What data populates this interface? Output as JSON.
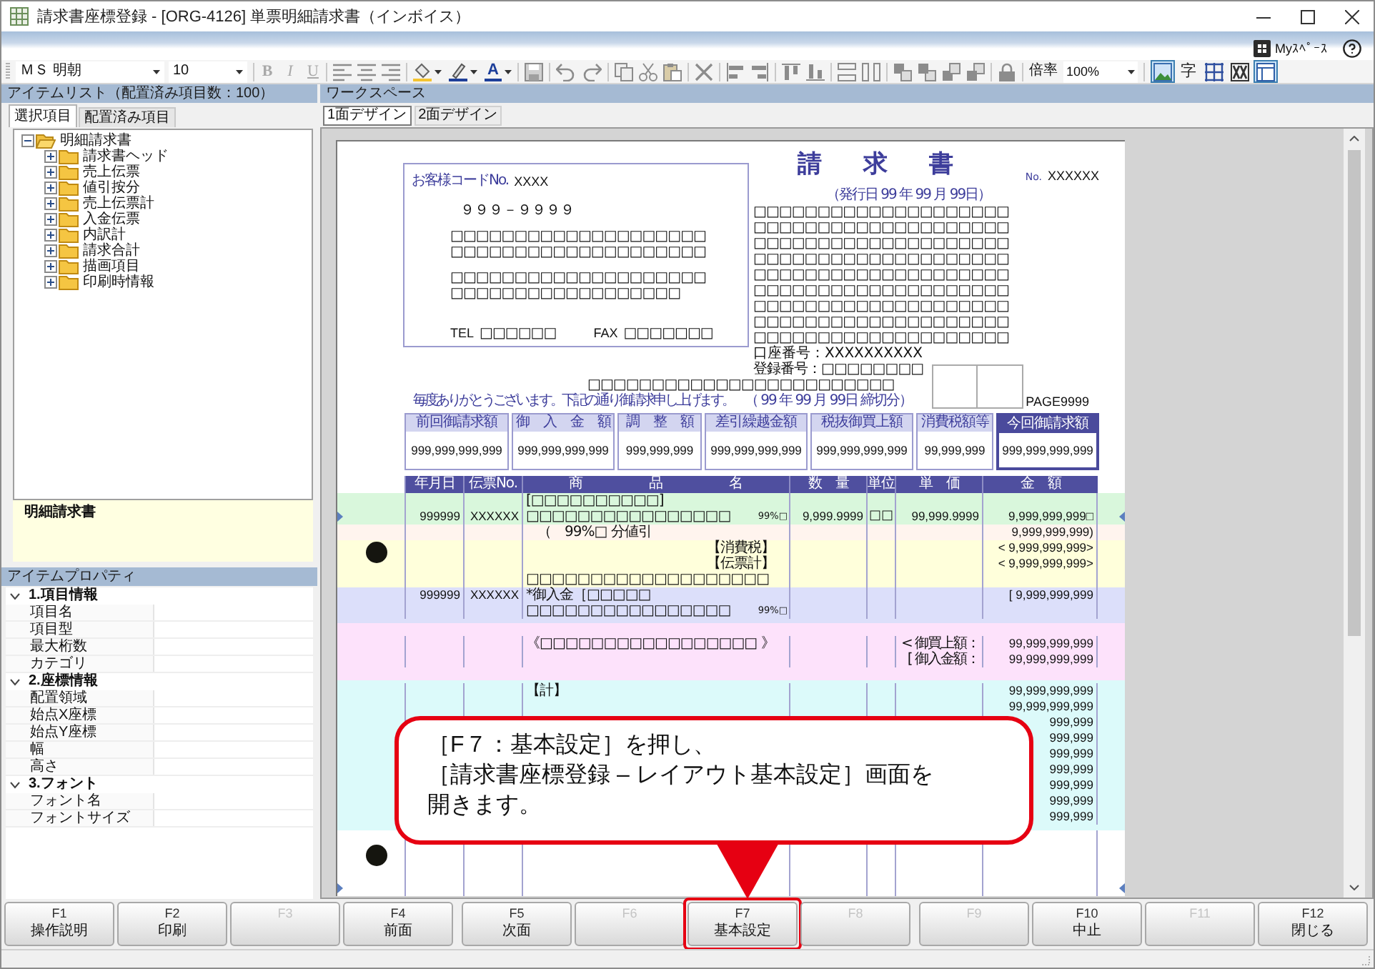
{
  "window": {
    "title": "請求書座標登録 - [ORG-4126] 単票明細請求書（インボイス）"
  },
  "header_bar": {
    "myspace": "Myｽﾍﾟｰｽ"
  },
  "toolbar": {
    "font": "ＭＳ 明朝",
    "font_size": "10",
    "format_buttons": [
      {
        "label": "B",
        "disabled": true
      },
      {
        "label": "I",
        "disabled": true
      },
      {
        "label": "U",
        "disabled": true
      }
    ],
    "font_color": "A",
    "zoom_label": "倍率",
    "zoom": "100%",
    "view_toggles": [
      {
        "kind": "picture",
        "selected": true
      },
      {
        "kind": "text",
        "label": "字",
        "selected": false
      },
      {
        "kind": "grid",
        "selected": false
      },
      {
        "kind": "frame",
        "selected": false
      },
      {
        "kind": "layout",
        "selected": true
      }
    ]
  },
  "item_list": {
    "title": "アイテムリスト（配置済み項目数：100）",
    "tabs": [
      {
        "label": "選択項目",
        "selected": true
      },
      {
        "label": "配置済み項目",
        "selected": false
      }
    ],
    "tree": [
      {
        "label": "明細請求書",
        "expanded": true,
        "children": [
          {
            "label": "請求書ヘッド",
            "expanded": false
          },
          {
            "label": "売上伝票",
            "expanded": false
          },
          {
            "label": "値引按分",
            "expanded": false
          },
          {
            "label": "売上伝票計",
            "expanded": false
          },
          {
            "label": "入金伝票",
            "expanded": false
          },
          {
            "label": "内訳計",
            "expanded": false
          },
          {
            "label": "請求合計",
            "expanded": false
          },
          {
            "label": "描画項目",
            "expanded": false
          },
          {
            "label": "印刷時情報",
            "expanded": false
          }
        ]
      }
    ],
    "description": "明細請求書"
  },
  "item_properties": {
    "title": "アイテムプロパティ",
    "categories": [
      {
        "label": "1.項目情報",
        "expanded": true,
        "properties": [
          "項目名",
          "項目型",
          "最大桁数",
          "カテゴリ"
        ]
      },
      {
        "label": "2.座標情報",
        "expanded": true,
        "properties": [
          "配置領域",
          "始点X座標",
          "始点Y座標",
          "幅",
          "高さ"
        ]
      },
      {
        "label": "3.フォント",
        "expanded": true,
        "properties": [
          "フォント名",
          "フォントサイズ"
        ]
      }
    ]
  },
  "workspace": {
    "title": "ワークスペース",
    "tabs": [
      {
        "label": "1面デザイン",
        "selected": true
      },
      {
        "label": "2面デザイン",
        "selected": false
      }
    ]
  },
  "invoice": {
    "customer_code_label": "お客様コードNo.",
    "customer_code": "XXXX",
    "postal_code": "９９９－９９９９",
    "address_lines": [
      "□□□□□□□□□□□□□□□□□□□□",
      "□□□□□□□□□□□□□□□□□□□□",
      "□□□□□□□□□□□□□□□□□□□□",
      "□□□□□□□□□□□□□□□□□□"
    ],
    "tel_label": "TEL",
    "tel": "□□□□□□",
    "fax_label": "FAX",
    "fax": "□□□□□□□",
    "title": "請　求　書",
    "number_label": "No.",
    "number": "XXXXXX",
    "issue_date": "（発行日 99 年 99 月 99日）",
    "issuer_lines": [
      "□□□□□□□□□□□□□□□□□□□□",
      "□□□□□□□□□□□□□□□□□□□□",
      "□□□□□□□□□□□□□□□□□□□□",
      "□□□□□□□□□□□□□□□□□□□□",
      "□□□□□□□□□□□□□□□□□□□□",
      "□□□□□□□□□□□□□□□□□□□□",
      "□□□□□□□□□□□□□□□□□□□□",
      "□□□□□□□□□□□□□□□□□□□□",
      "□□□□□□□□□□□□□□□□□□□□"
    ],
    "account": "口座番号：XXXXXXXXXX",
    "registration": "登録番号：□□□□□□□□",
    "recipient_line": "□□□□□□□□□□□□□□□□□□□□□□□□",
    "greeting": "毎度ありがとうございます。下記の通り御請求申し上げます。",
    "closing_date": "（ 99 年 99 月 99日 締切分）",
    "page": "PAGE9999",
    "summary": [
      {
        "label": "前回御請求額",
        "value": "999,999,999,999",
        "highlighted": false
      },
      {
        "label": "御　入　金　額",
        "value": "999,999,999,999",
        "highlighted": false
      },
      {
        "label": "調　整　額",
        "value": "999,999,999",
        "highlighted": false
      },
      {
        "label": "差引繰越金額",
        "value": "999,999,999,999",
        "highlighted": false
      },
      {
        "label": "税抜御買上額",
        "value": "999,999,999,999",
        "highlighted": false
      },
      {
        "label": "消費税額等",
        "value": "99,999,999",
        "highlighted": false
      },
      {
        "label": "今回御請求額",
        "value": "999,999,999,999",
        "highlighted": true
      }
    ],
    "detail_columns": [
      "年月日",
      "伝票No.",
      "商　品　名",
      "数　量",
      "単位",
      "単　価",
      "金　額"
    ],
    "detail_bands": [
      {
        "color": "#d9f7dc",
        "punch_hole": false,
        "rows": [
          {
            "kind": "item",
            "product": "[□□□□□□□□□□]",
            "marked": false
          },
          {
            "kind": "item",
            "marked": true,
            "date": "999999",
            "slip": "XXXXXX",
            "product": "□□□□□□□□□□□□□□□□",
            "tax_rate": "99%□",
            "quantity": "9,999.9999",
            "unit": "□□",
            "unit_price": "99,999.9999",
            "amount": "9,999,999,999□"
          }
        ]
      },
      {
        "color": "#fff4ee",
        "punch_hole": false,
        "rows": [
          {
            "kind": "discount",
            "marked": false,
            "product": "（　99%□ 分値引",
            "amount": "9,999,999,999)"
          }
        ]
      },
      {
        "color": "#ffffdb",
        "punch_hole": true,
        "rows": [
          {
            "kind": "subtotal",
            "marked": false,
            "product": "【消費税】",
            "amount": "< 9,999,999,999>"
          },
          {
            "kind": "subtotal",
            "marked": false,
            "product": "【伝票計】",
            "amount": "< 9,999,999,999>"
          },
          {
            "kind": "item",
            "marked": false,
            "product": "□□□□□□□□□□□□□□□□□□□"
          }
        ]
      },
      {
        "color": "#dcdffa",
        "punch_hole": false,
        "rows": [
          {
            "kind": "item",
            "marked": false,
            "date": "999999",
            "slip": "XXXXXX",
            "product": "*御入金［□□□□□",
            "amount": "[ 9,999,999,999"
          },
          {
            "kind": "item",
            "marked": false,
            "product": "□□□□□□□□□□□□□□□□",
            "tax_rate": "99%□"
          }
        ]
      },
      {
        "color": "#fde2fb",
        "punch_hole": false,
        "rows": [
          {
            "kind": "item",
            "marked": false,
            "product": "《□□□□□□□□□□□□□□□□□ 》",
            "unit_price": "< 御買上額：",
            "amount": "99,999,999,999"
          },
          {
            "kind": "item",
            "marked": false,
            "unit_price": "[ 御入金額：",
            "amount": "99,999,999,999"
          }
        ]
      },
      {
        "color": "#dcfafa",
        "punch_hole": false,
        "rows": [
          {
            "kind": "item",
            "marked": false,
            "product": "【計】",
            "amount": "99,999,999,999"
          },
          {
            "kind": "item",
            "marked": false,
            "amount": "99,999,999,999"
          },
          {
            "kind": "item",
            "marked": false,
            "amount": "999,999"
          },
          {
            "kind": "item",
            "marked": false,
            "amount": "999,999"
          },
          {
            "kind": "item",
            "marked": false,
            "amount": "999,999"
          },
          {
            "kind": "item",
            "marked": false,
            "amount": "999,999"
          },
          {
            "kind": "item",
            "marked": false,
            "amount": "999,999"
          },
          {
            "kind": "item",
            "marked": false,
            "amount": "999,999"
          },
          {
            "kind": "item",
            "marked": false,
            "amount": "999,999"
          }
        ]
      },
      {
        "color": "#ffffff",
        "punch_hole": true
      }
    ]
  },
  "function_keys": [
    {
      "key": "F1",
      "label": "操作説明",
      "disabled": false,
      "highlighted": false
    },
    {
      "key": "F2",
      "label": "印刷",
      "disabled": false,
      "highlighted": false
    },
    {
      "key": "F3",
      "disabled": true,
      "highlighted": false
    },
    {
      "key": "F4",
      "label": "前面",
      "disabled": false,
      "highlighted": false
    },
    {
      "key": "F5",
      "label": "次面",
      "disabled": false,
      "highlighted": false
    },
    {
      "key": "F6",
      "disabled": true,
      "highlighted": false
    },
    {
      "key": "F7",
      "label": "基本設定",
      "disabled": false,
      "highlighted": true
    },
    {
      "key": "F8",
      "disabled": true,
      "highlighted": false
    },
    {
      "key": "F9",
      "disabled": true,
      "highlighted": false
    },
    {
      "key": "F10",
      "label": "中止",
      "disabled": false,
      "highlighted": false
    },
    {
      "key": "F11",
      "disabled": true,
      "highlighted": false
    },
    {
      "key": "F12",
      "label": "閉じる",
      "disabled": false,
      "highlighted": false
    }
  ],
  "callout": {
    "lines": [
      "［F７：基本設定］を押し、",
      "［請求書座標登録 – レイアウト基本設定］画面を",
      "開きます。"
    ]
  }
}
